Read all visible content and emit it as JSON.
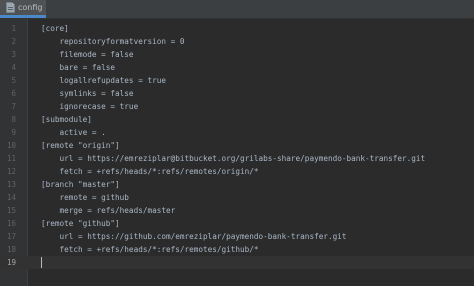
{
  "tab": {
    "title": "config",
    "icon": "file-icon"
  },
  "editor": {
    "lines": [
      {
        "n": "1",
        "text": "[core]"
      },
      {
        "n": "2",
        "text": "    repositoryformatversion = 0"
      },
      {
        "n": "3",
        "text": "    filemode = false"
      },
      {
        "n": "4",
        "text": "    bare = false"
      },
      {
        "n": "5",
        "text": "    logallrefupdates = true"
      },
      {
        "n": "6",
        "text": "    symlinks = false"
      },
      {
        "n": "7",
        "text": "    ignorecase = true"
      },
      {
        "n": "8",
        "text": "[submodule]"
      },
      {
        "n": "9",
        "text": "    active = ."
      },
      {
        "n": "10",
        "text": "[remote \"origin\"]"
      },
      {
        "n": "11",
        "text": "    url = https://emreziplar@bitbucket.org/grilabs-share/paymendo-bank-transfer.git"
      },
      {
        "n": "12",
        "text": "    fetch = +refs/heads/*:refs/remotes/origin/*"
      },
      {
        "n": "13",
        "text": "[branch \"master\"]"
      },
      {
        "n": "14",
        "text": "    remote = github"
      },
      {
        "n": "15",
        "text": "    merge = refs/heads/master"
      },
      {
        "n": "16",
        "text": "[remote \"github\"]"
      },
      {
        "n": "17",
        "text": "    url = https://github.com/emreziplar/paymendo-bank-transfer.git"
      },
      {
        "n": "18",
        "text": "    fetch = +refs/heads/*:refs/remotes/github/*"
      },
      {
        "n": "19",
        "text": ""
      }
    ],
    "current_line": "19"
  },
  "colors": {
    "background": "#2b2b2b",
    "gutter": "#313335",
    "text": "#a9b7c6",
    "line_number": "#606366",
    "tab_accent": "#4a88c7"
  }
}
